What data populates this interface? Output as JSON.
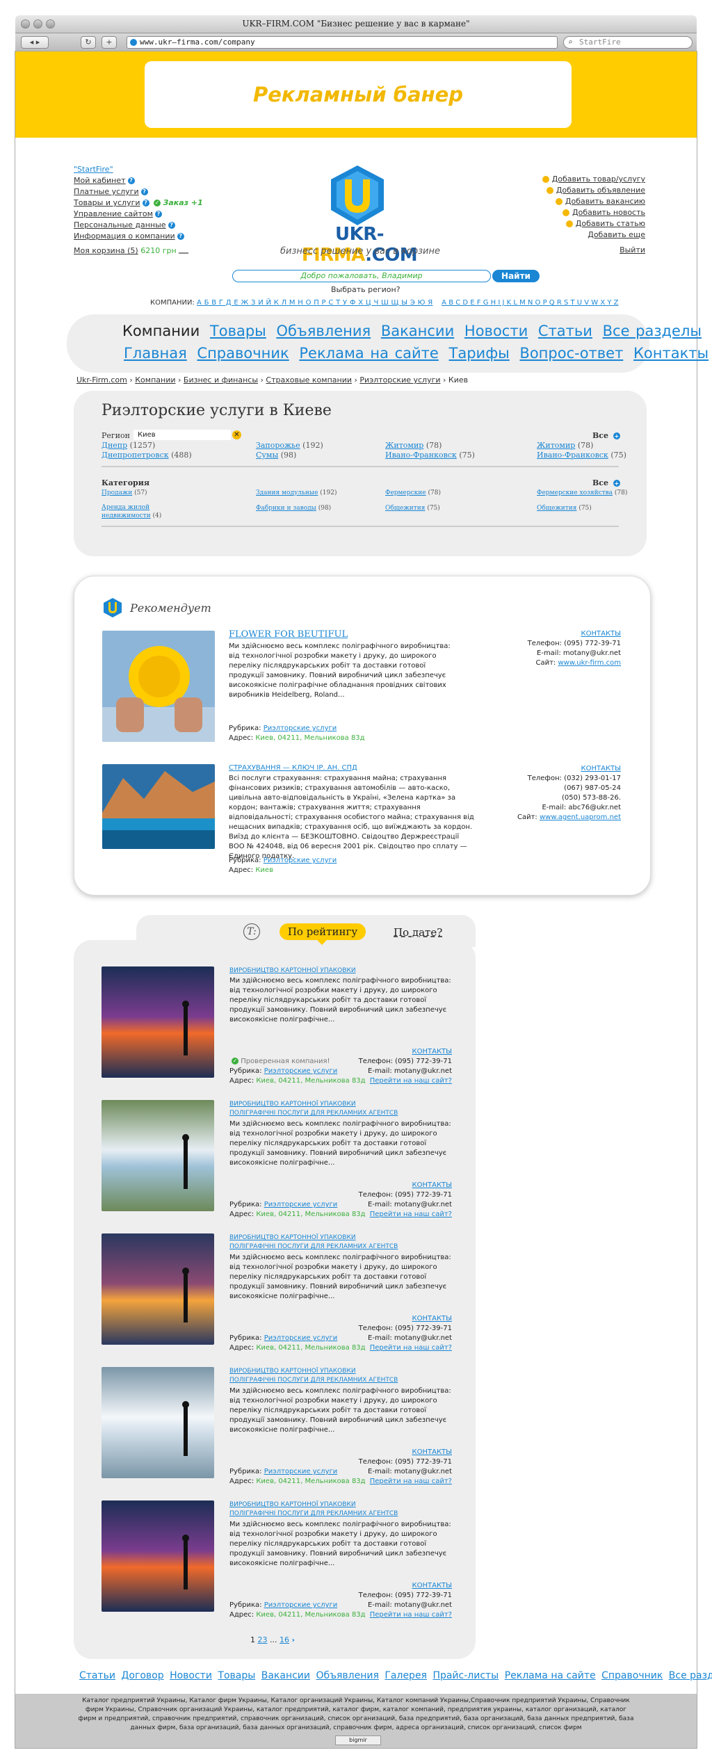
{
  "browser": {
    "window_title": "UKR–FIRM.COM \"Бизнес решение у вас в кармане\"",
    "url": "www.ukr–firma.com/company",
    "search_placeholder": "StartFire",
    "back": "◂ ▸",
    "reload": "↻",
    "add": "+"
  },
  "banner": {
    "text": "Рекламный банер"
  },
  "header": {
    "left_menu": [
      {
        "label": "\"StartFire\""
      },
      {
        "label": "Мой кабинет"
      },
      {
        "label": "Платные услуги"
      },
      {
        "label": "Товары и услуги",
        "extra": "Заказ +1"
      },
      {
        "label": "Управление сайтом"
      },
      {
        "label": "Персональные данные"
      },
      {
        "label": "Информация о компании"
      }
    ],
    "cart_label": "Моя корзина (5)",
    "cart_sum": "6210 грн",
    "logo_main": "UKR-",
    "logo_accent": "FIRMA",
    "logo_tail": ".COM",
    "slogan": "бизнесс решение у вас в корзине",
    "right_menu": [
      "Добавить товар/услугу",
      "Добавить объявление",
      "Добавить вакансию",
      "Добавить новость",
      "Добавить статью"
    ],
    "add_more": "Добавить еще",
    "logout": "Выйти",
    "welcome": "Добро пожаловать, Владимир",
    "find_button": "Найти",
    "region_select": "Выбрать регион?",
    "alphabet_label": "КОМПАНИИ:",
    "alphabet_cyr": "А Б В Г Д Е Ж З И Й К Л М Н О П Р С Т У Ф Х Ц Ч Ш Щ Ы Э Ю Я",
    "alphabet_lat": "A B C D E F G H I J K L M N O P Q R S T U V W X Y Z"
  },
  "mainnav": {
    "row1": [
      "Компании",
      "Товары",
      "Объявления",
      "Вакансии",
      "Новости",
      "Статьи",
      "Все разделы"
    ],
    "row2": [
      "Главная",
      "Справочник",
      "Реклама на сайте",
      "Тарифы",
      "Вопрос-ответ",
      "Контакты"
    ]
  },
  "breadcrumbs": [
    "Ukr-Firm.com",
    "Компании",
    "Бизнес и финансы",
    "Страховые компании",
    "Риэлторские услуги",
    "Киев"
  ],
  "realtor": {
    "title": "Риэлторские услуги в Киеве",
    "region_label": "Регион",
    "region_value": "Киев",
    "all_label": "Все",
    "regions": [
      [
        "Днепр",
        "(1257)"
      ],
      [
        "Запорожье",
        "(192)"
      ],
      [
        "Житомир",
        "(78)"
      ],
      [
        "Житомир",
        "(78)"
      ],
      [
        "Днепропетровск",
        "(488)"
      ],
      [
        "Сумы",
        "(98)"
      ],
      [
        "Ивано-Франковск",
        "(75)"
      ],
      [
        "Ивано-Франковск",
        "(75)"
      ]
    ],
    "category_label": "Категория",
    "categories": [
      [
        "Продажи",
        "(57)"
      ],
      [
        "Здания модульные",
        "(192)"
      ],
      [
        "Фермерские",
        "(78)"
      ],
      [
        "Фермерские хозяйства",
        "(78)"
      ],
      [
        "Аренда жилой",
        ""
      ],
      [
        "Фабрики и заводы",
        "(98)"
      ],
      [
        "Общежития",
        "(75)"
      ],
      [
        "Общежития",
        "(75)"
      ]
    ],
    "cat_extra_line": "недвижимости",
    "cat_extra_count": "(4)"
  },
  "recommend": {
    "title": "Рекомендует",
    "cards": [
      {
        "title": "FLOWER FOR BEUTIFUL",
        "desc": "Ми здійснюємо весь комплекс поліграфічного виробництва: від технологічної розробки макету і друку, до широкого переліку післядрукарських робіт та доставки готової продукції замовнику. Повний виробничий цикл забезпечує високоякісне поліграфічне обладнання провідних світових виробників Heidelberg, Roland...",
        "rubric_label": "Рубрика:",
        "rubric": "Риэлторские услуги",
        "address_label": "Адрес:",
        "address": "Киев, 04211, Мельникова 83д",
        "contacts": "КОНТАКТЫ",
        "lines": [
          "Телефон: (095) 772-39-71",
          "E-mail: motany@ukr.net"
        ],
        "site_label": "Сайт:",
        "site": "www.ukr-firm.com"
      },
      {
        "title": "СТРАХУВАННЯ — Ключ Ір. Ан. СПД",
        "desc": "Всі послуги страхування: страхування майна; страхування фінансових ризиків; страхування автомобілів — авто-каско, цивільна авто-відповідальність в Україні, «Зелена картка» за кордон; вантажів; страхування життя; страхування відповідальності; страхування особистого майна; страхування від нещасних випадків; страхування осіб, що виїжджають за кордон. Виїзд до клієнта — БЕЗКОШТОВНО. Свідоцтво Держреєстрації ВОО № 424048, від 06 вересня 2001 рік. Свідоцтво про сплату — Єдиного податку.",
        "rubric_label": "Рубрика:",
        "rubric": "Риэлторские услуги",
        "address_label": "Адрес:",
        "address": "Киев",
        "contacts": "КОНТАКТЫ",
        "lines": [
          "Телефон: (032) 293-01-17",
          "(067) 987-05-24",
          "(050) 573-88-26.",
          "E-mail: abc76@ukr.net"
        ],
        "site_label": "Сайт:",
        "site": "www.agent.uaprom.net"
      }
    ]
  },
  "rating": {
    "tab_t": "T:",
    "tab_active": "По рейтингу",
    "tab_date": "По дате?",
    "verified": "Проверенная компания!",
    "items": [
      {
        "title1": "ВИРОБНИЦТВО КАРТОННОЇ УПАКОВКИ",
        "title2": ""
      },
      {
        "title1": "ВИРОБНИЦТВО КАРТОННОЇ УПАКОВКИ",
        "title2": "ПОЛІГРАФІЧНІ ПОСЛУГИ ДЛЯ РЕКЛАМНИХ АГЕНТСВ"
      },
      {
        "title1": "ВИРОБНИЦТВО КАРТОННОЇ УПАКОВКИ",
        "title2": "ПОЛІГРАФІЧНІ ПОСЛУГИ ДЛЯ РЕКЛАМНИХ АГЕНТСВ"
      },
      {
        "title1": "ВИРОБНИЦТВО КАРТОННОЇ УПАКОВКИ",
        "title2": "ПОЛІГРАФІЧНІ ПОСЛУГИ ДЛЯ РЕКЛАМНИХ АГЕНТСВ"
      },
      {
        "title1": "ВИРОБНИЦТВО КАРТОННОЇ УПАКОВКИ",
        "title2": "ПОЛІГРАФІЧНІ ПОСЛУГИ ДЛЯ РЕКЛАМНИХ АГЕНТСВ"
      }
    ],
    "desc": "Ми здійснюємо весь комплекс поліграфічного виробництва: від технологічної розробки макету і друку, до широкого переліку післядрукарських робіт та доставки готової продукції замовнику. Повний виробничий цикл забезпечує високоякісне поліграфічне...",
    "contacts": "КОНТАКТЫ",
    "phone": "Телефон: (095) 772-39-71",
    "email": "E-mail: motany@ukr.net",
    "goto": "Перейти на наш сайт?",
    "rubric_label": "Рубрика:",
    "rubric": "Риэлторские услуги",
    "address_label": "Адрес:",
    "address": "Киев, 04211, Мельникова 83д",
    "pager": [
      "1",
      "2",
      "3",
      "...",
      "16"
    ]
  },
  "footer_nav": [
    "Статьи",
    "Договор",
    "Новости",
    "Товары",
    "Вакансии",
    "Объявления",
    "Галерея",
    "Прайс-листы",
    "Реклама на сайте",
    "Справочник",
    "Все разделы"
  ],
  "footer_text": "Каталог предприятий Украины, Каталог фирм Украины, Каталог организаций Украины, Каталог компаний Украины,Справочник предприятий Украины, Справочник фирм Украины, Справочник организаций Украины, каталог предприятий, каталог фирм, каталог компаний, предприятия украины, каталог организаций, каталог фирм и предприятий, справочник предприятий, справочник организаций, список организаций, база предприятий, база организаций, база данных предприятий, база данных фирм, база организаций, база данных организаций, справочник фирм, адреса организаций, список организаций, список фирм",
  "counter": "bigmir"
}
